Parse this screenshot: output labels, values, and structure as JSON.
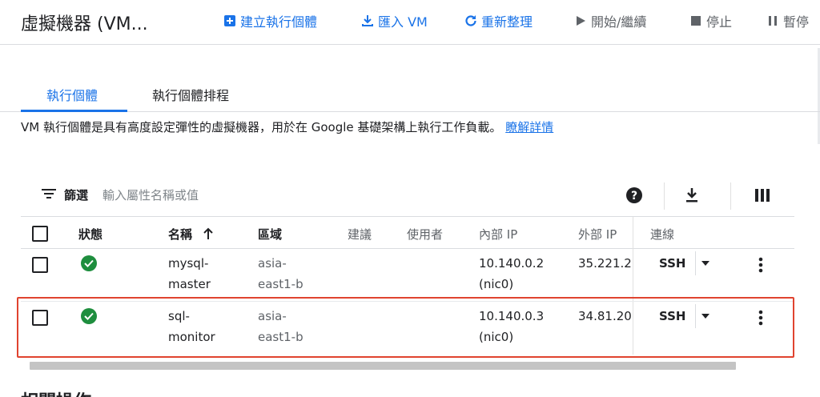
{
  "header": {
    "title": "虛擬機器 (VM...",
    "create_label": "建立執行個體",
    "import_label": "匯入 VM",
    "refresh_label": "重新整理",
    "start_label": "開始/繼續",
    "stop_label": "停止",
    "pause_label": "暫停"
  },
  "tabs": [
    {
      "label": "執行個體"
    },
    {
      "label": "執行個體排程"
    }
  ],
  "description": {
    "text": "VM 執行個體是具有高度設定彈性的虛擬機器，用於在 Google 基礎架構上執行工作負載。",
    "link": "瞭解詳情"
  },
  "filter": {
    "label": "篩選",
    "placeholder": "輸入屬性名稱或值"
  },
  "table": {
    "columns": {
      "status": "狀態",
      "name": "名稱",
      "zone": "區域",
      "recommendation": "建議",
      "in_use_by": "使用者",
      "internal_ip": "內部 IP",
      "external_ip": "外部 IP",
      "connect": "連線"
    },
    "rows": [
      {
        "name_line1": "mysql-",
        "name_line2": "master",
        "zone_line1": "asia-",
        "zone_line2": "east1-b",
        "internal_ip_line1": "10.140.0.2",
        "internal_ip_line2": "(nic0)",
        "external_ip": "35.221.2",
        "connect": "SSH"
      },
      {
        "name_line1": "sql-",
        "name_line2": "monitor",
        "zone_line1": "asia-",
        "zone_line2": "east1-b",
        "internal_ip_line1": "10.140.0.3",
        "internal_ip_line2": "(nic0)",
        "external_ip": "34.81.20",
        "connect": "SSH"
      }
    ]
  },
  "section": {
    "title": "相關操作"
  },
  "colors": {
    "accent": "#1a73e8",
    "status_ok": "#1e8e3e",
    "highlight": "#e0432f"
  }
}
